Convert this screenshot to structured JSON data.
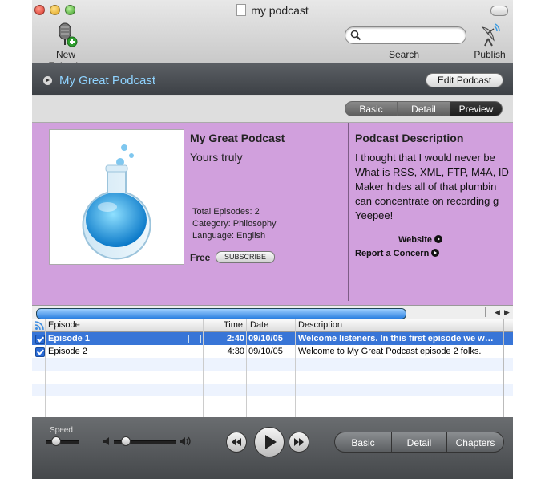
{
  "window": {
    "title": "my podcast"
  },
  "toolbar": {
    "new_episode": "New Episode",
    "search": "Search",
    "publish": "Publish"
  },
  "header": {
    "title": "My Great Podcast",
    "edit_button": "Edit Podcast"
  },
  "view_tabs": {
    "basic": "Basic",
    "detail": "Detail",
    "preview": "Preview",
    "selected": "Preview"
  },
  "preview": {
    "name": "My Great Podcast",
    "author": "Yours truly",
    "total_episodes": "Total Episodes: 2",
    "category": "Category: Philosophy",
    "language": "Language: English",
    "price": "Free",
    "subscribe": "SUBSCRIBE",
    "description_heading": "Podcast Description",
    "description": "I thought that I would never be\nWhat is RSS, XML, FTP, M4A, ID\nMaker hides all of that plumbin\ncan concentrate on recording g\nYeepee!",
    "website": "Website",
    "report": "Report a Concern"
  },
  "episodes": {
    "columns": {
      "episode": "Episode",
      "time": "Time",
      "date": "Date",
      "description": "Description"
    },
    "rows": [
      {
        "title": "Episode 1",
        "time": "2:40",
        "date": "09/10/05",
        "description": "Welcome listeners. In this first episode we w…",
        "selected": true,
        "checked": true
      },
      {
        "title": "Episode 2",
        "time": "4:30",
        "date": "09/10/05",
        "description": "Welcome to My Great Podcast episode 2 folks.",
        "selected": false,
        "checked": true
      }
    ]
  },
  "player": {
    "speed_label": "Speed",
    "tabs": {
      "basic": "Basic",
      "detail": "Detail",
      "chapters": "Chapters"
    }
  },
  "icons": {
    "play": "play-icon",
    "rewind": "rewind-icon",
    "forward": "fast-forward-icon",
    "search": "search-icon",
    "publish": "satellite-icon",
    "new_episode": "microphone-add-icon"
  },
  "colors": {
    "preview_bg": "#d1a0dd",
    "header_title": "#8fd3ff",
    "selection": "#3875d7"
  }
}
